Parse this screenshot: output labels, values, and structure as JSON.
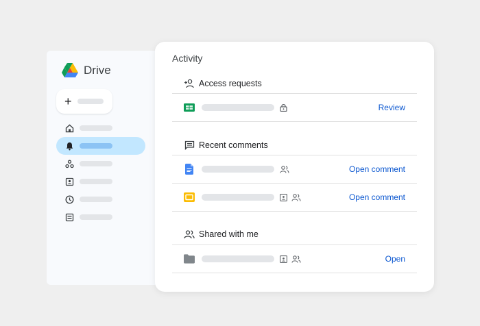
{
  "app": {
    "name": "Drive"
  },
  "sidebar": {
    "new_button": {
      "glyph": "+"
    },
    "items": [
      {
        "icon": "home-icon",
        "active": false
      },
      {
        "icon": "bell-icon",
        "active": true
      },
      {
        "icon": "workspaces-icon",
        "active": false
      },
      {
        "icon": "shared-drive-icon",
        "active": false
      },
      {
        "icon": "clock-icon",
        "active": false
      },
      {
        "icon": "storage-icon",
        "active": false
      }
    ]
  },
  "activity": {
    "title": "Activity",
    "sections": [
      {
        "label": "Access requests",
        "icon": "person-add-icon",
        "rows": [
          {
            "file_icon": "sheets-file-icon",
            "meta": [
              "lock-icon"
            ],
            "action": "Review"
          }
        ]
      },
      {
        "label": "Recent comments",
        "icon": "comment-icon",
        "rows": [
          {
            "file_icon": "docs-file-icon",
            "meta": [
              "people-icon"
            ],
            "action": "Open comment"
          },
          {
            "file_icon": "slides-file-icon",
            "meta": [
              "shared-drive-icon",
              "people-icon"
            ],
            "action": "Open comment"
          }
        ]
      },
      {
        "label": "Shared with me",
        "icon": "people-icon",
        "rows": [
          {
            "file_icon": "folder-icon",
            "meta": [
              "shared-drive-icon",
              "people-icon"
            ],
            "action": "Open"
          }
        ]
      }
    ]
  },
  "colors": {
    "background": "#efefef",
    "accent_link": "#0b57d0",
    "active_nav": "#c2e7ff",
    "docs_blue": "#4285f4",
    "sheets_green": "#0f9d58",
    "slides_yellow": "#fbbc04"
  }
}
